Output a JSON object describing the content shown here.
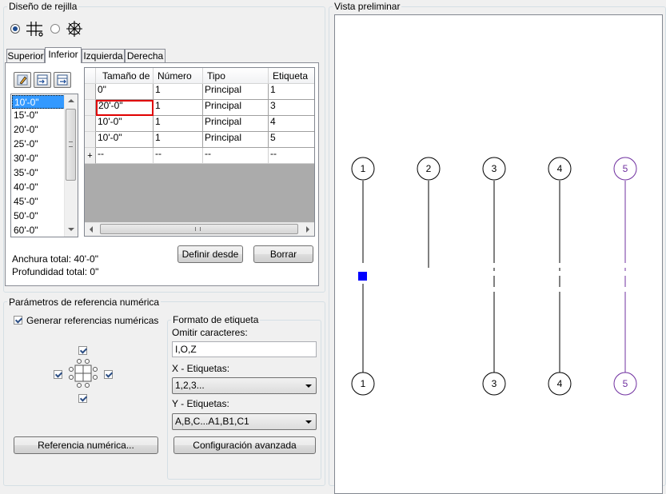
{
  "grid_design": {
    "title": "Diseño de rejilla",
    "tabs": [
      "Superior",
      "Inferior",
      "Izquierda",
      "Derecha"
    ],
    "sizes_list": [
      "10'-0\"",
      "15'-0\"",
      "20'-0\"",
      "25'-0\"",
      "30'-0\"",
      "35'-0\"",
      "40'-0\"",
      "45'-0\"",
      "50'-0\"",
      "60'-0\""
    ],
    "table": {
      "columns": [
        "Tamaño de",
        "Número",
        "Tipo",
        "Etiqueta"
      ],
      "rows": [
        [
          "0\"",
          "1",
          "Principal",
          "1"
        ],
        [
          "20'-0\"",
          "1",
          "Principal",
          "3"
        ],
        [
          "10'-0\"",
          "1",
          "Principal",
          "4"
        ],
        [
          "10'-0\"",
          "1",
          "Principal",
          "5"
        ]
      ],
      "new_row": [
        "--",
        "--",
        "--",
        "--"
      ],
      "new_row_marker": "+"
    },
    "total_width": "Anchura total: 40'-0\"",
    "total_depth": "Profundidad total: 0\"",
    "define_from_btn": "Definir desde",
    "delete_btn": "Borrar"
  },
  "bubble_params": {
    "title": "Parámetros de referencia numérica",
    "generate_label": "Generar referencias numéricas",
    "bubble_ref_btn": "Referencia numérica...",
    "label_format": {
      "title": "Formato de etiqueta",
      "omit_label": "Omitir caracteres:",
      "omit_value": "I,O,Z",
      "x_label": "X - Etiquetas:",
      "x_value": "1,2,3...",
      "y_label": "Y - Etiquetas:",
      "y_value": "A,B,C...A1,B1,C1",
      "advanced_btn": "Configuración avanzada"
    }
  },
  "preview": {
    "title": "Vista preliminar",
    "top_bubbles": [
      "1",
      "2",
      "3",
      "4",
      "5"
    ],
    "bottom_bubbles": [
      "1",
      "3",
      "4",
      "5"
    ],
    "highlight_color": "#7030a0"
  }
}
